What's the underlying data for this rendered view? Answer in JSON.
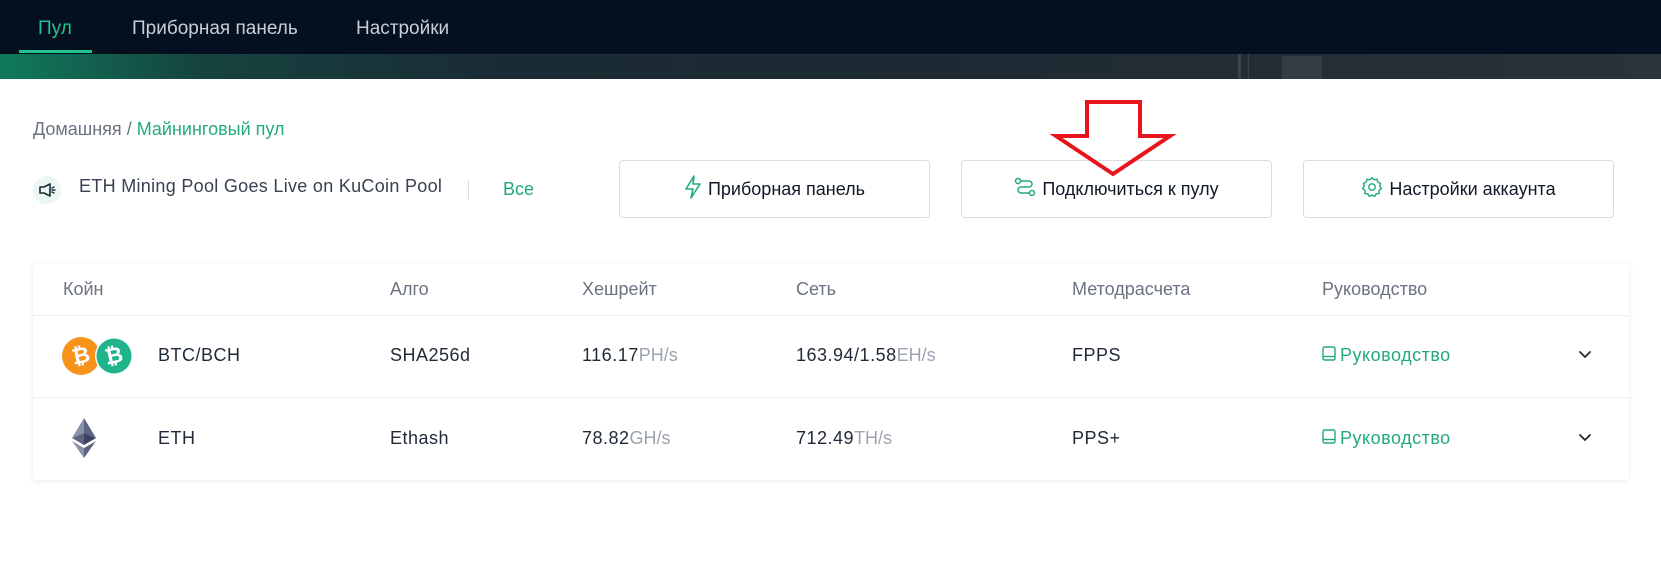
{
  "nav": {
    "items": [
      {
        "label": "Пул",
        "active": true
      },
      {
        "label": "Приборная панель",
        "active": false
      },
      {
        "label": "Настройки",
        "active": false
      }
    ],
    "accent_color": "#23c48f"
  },
  "breadcrumb": {
    "home": "Домашняя",
    "separator": "/",
    "current": "Майнинговый пул"
  },
  "announcement": {
    "icon": "megaphone-icon",
    "text": "ETH Mining Pool Goes Live on KuCoin Pool",
    "all_link": "Все"
  },
  "actions": [
    {
      "label": "Приборная панель",
      "icon": "lightning-icon"
    },
    {
      "label": "Подключиться к пулу",
      "icon": "route-icon"
    },
    {
      "label": "Настройки аккаунта",
      "icon": "gear-icon"
    }
  ],
  "annotation": {
    "type": "red-arrow-down",
    "color": "#e8141c"
  },
  "table": {
    "headers": [
      "Койн",
      "Алго",
      "Хешрейт",
      "Сеть",
      "Методрасчета",
      "Руководство"
    ],
    "rows": [
      {
        "coin": "BTC/BCH",
        "icons": [
          "bitcoin-icon",
          "bitcoin-cash-icon"
        ],
        "algo": "SHA256d",
        "hashrate_value": "116.17",
        "hashrate_unit": "PH/s",
        "network_value": "163.94/1.58",
        "network_unit": "EH/s",
        "method": "FPPS",
        "guide": "Руководство"
      },
      {
        "coin": "ETH",
        "icons": [
          "ethereum-icon"
        ],
        "algo": "Ethash",
        "hashrate_value": "78.82",
        "hashrate_unit": "GH/s",
        "network_value": "712.49",
        "network_unit": "TH/s",
        "method": "PPS+",
        "guide": "Руководство"
      }
    ]
  }
}
